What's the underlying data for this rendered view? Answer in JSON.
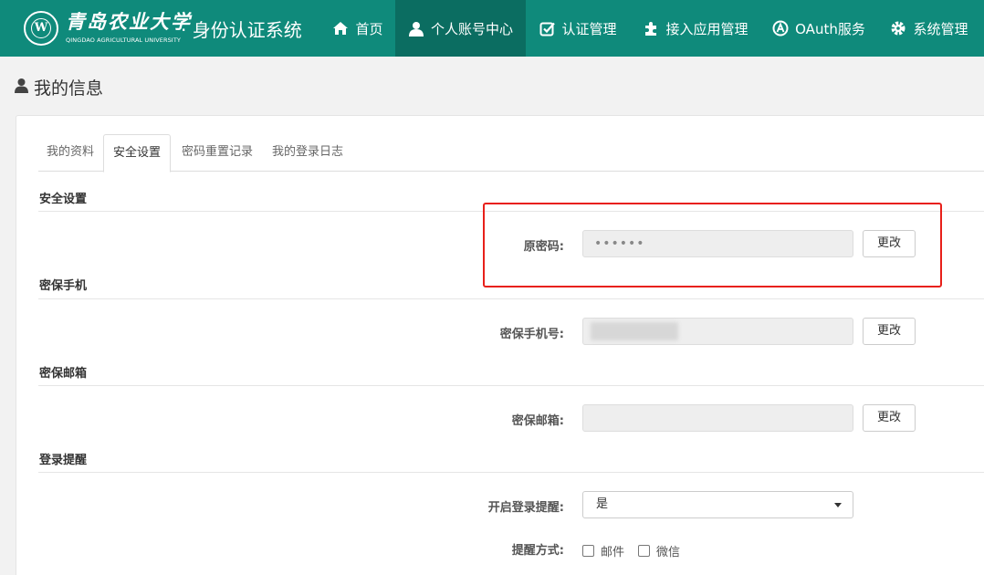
{
  "header": {
    "logo_cn": "青岛农业大学",
    "logo_en": "QINGDAO AGRICULTURAL UNIVERSITY",
    "system_title": "· 身份认证系统",
    "nav": [
      {
        "label": "首页",
        "icon": "home-icon"
      },
      {
        "label": "个人账号中心",
        "icon": "user-icon",
        "active": true
      },
      {
        "label": "认证管理",
        "icon": "check-square-icon"
      },
      {
        "label": "接入应用管理",
        "icon": "puzzle-icon"
      },
      {
        "label": "OAuth服务",
        "icon": "oauth-icon"
      },
      {
        "label": "系统管理",
        "icon": "gear-icon"
      }
    ]
  },
  "page": {
    "title": "我的信息"
  },
  "tabs": [
    {
      "label": "我的资料"
    },
    {
      "label": "安全设置",
      "active": true
    },
    {
      "label": "密码重置记录"
    },
    {
      "label": "我的登录日志"
    }
  ],
  "sections": {
    "security": {
      "title": "安全设置",
      "label": "原密码:",
      "value": "••••••",
      "button": "更改"
    },
    "phone": {
      "title": "密保手机",
      "label": "密保手机号:",
      "value": "",
      "button": "更改"
    },
    "email": {
      "title": "密保邮箱",
      "label": "密保邮箱:",
      "value": "",
      "button": "更改"
    },
    "login_alert": {
      "title": "登录提醒",
      "enable_label": "开启登录提醒:",
      "enable_value": "是",
      "method_label": "提醒方式:",
      "methods": [
        {
          "label": "邮件",
          "checked": false
        },
        {
          "label": "微信",
          "checked": false
        }
      ]
    }
  },
  "colors": {
    "header_bg": "#0f8a7b",
    "header_active": "#0b6d61",
    "highlight": "#e8201a"
  }
}
